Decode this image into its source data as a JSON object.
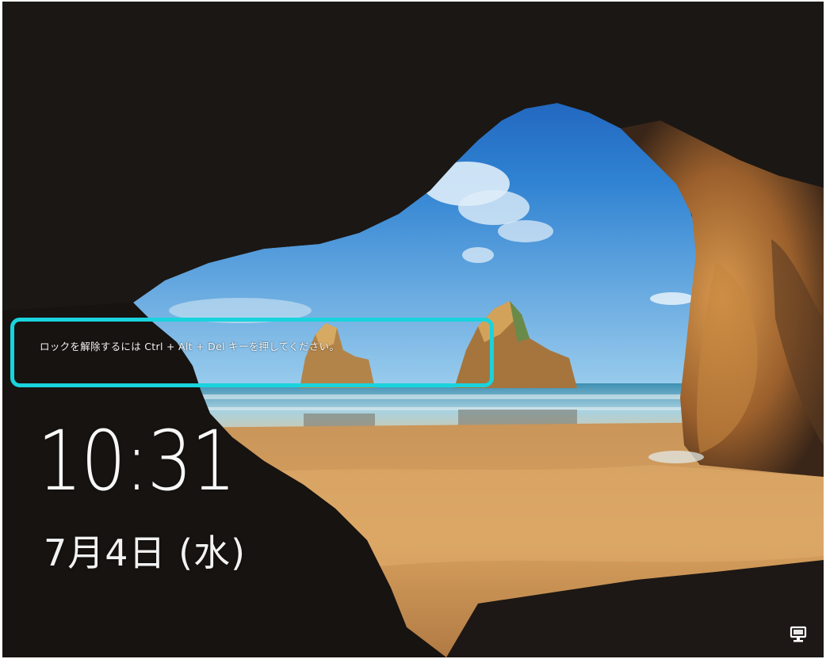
{
  "lock_screen": {
    "unlock_hint": "ロックを解除するには Ctrl + Alt + Del キーを押してください。",
    "time": "10:31",
    "date": "7月4日 (水)"
  },
  "highlight": {
    "color": "#19d3dd"
  },
  "icons": {
    "network": "network-icon"
  }
}
